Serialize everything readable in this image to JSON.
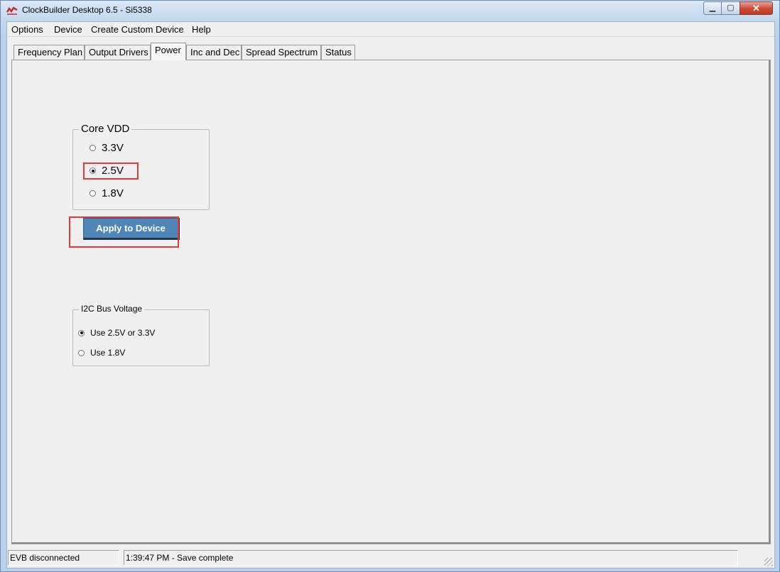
{
  "window": {
    "title": "ClockBuilder Desktop 6.5 - Si5338",
    "icon": "app-logo-icon",
    "controls": {
      "minimize": "minimize-icon",
      "maximize": "maximize-icon",
      "close": "close-icon"
    }
  },
  "menu": {
    "items": [
      "Options",
      "Device",
      "Create Custom Device",
      "Help"
    ]
  },
  "tabs": {
    "items": [
      "Frequency Plan",
      "Output Drivers",
      "Power",
      "Inc and Dec",
      "Spread Spectrum",
      "Status"
    ],
    "active": "Power"
  },
  "core_vdd": {
    "label": "Core VDD",
    "options": [
      "3.3V",
      "2.5V",
      "1.8V"
    ],
    "selected": "2.5V"
  },
  "apply_button": {
    "label": "Apply to Device",
    "color": "#4f86b8"
  },
  "i2c": {
    "label": "I2C Bus Voltage",
    "options": [
      "Use 2.5V or 3.3V",
      "Use 1.8V"
    ],
    "selected": "Use 2.5V or 3.3V"
  },
  "status": {
    "connection": "EVB disconnected",
    "message": "1:39:47 PM - Save complete"
  },
  "highlight_color": "#e53935"
}
